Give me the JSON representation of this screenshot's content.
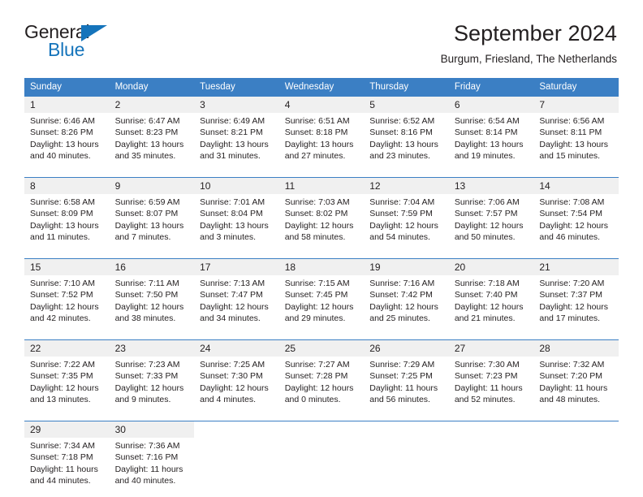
{
  "logo": {
    "word_one": "General",
    "word_two": "Blue",
    "triangle": "triangle-shape",
    "brand_color": "#1574bb"
  },
  "header": {
    "title": "September 2024",
    "location": "Burgum, Friesland, The Netherlands"
  },
  "theme": {
    "header_bg": "#3b7fc4",
    "daynum_bg": "#f0f0f0",
    "cell_bg": "#ffffff",
    "text": "#231f20"
  },
  "weekday_headers": [
    "Sunday",
    "Monday",
    "Tuesday",
    "Wednesday",
    "Thursday",
    "Friday",
    "Saturday"
  ],
  "weeks": [
    {
      "days": [
        {
          "num": "1",
          "sunrise": "Sunrise: 6:46 AM",
          "sunset": "Sunset: 8:26 PM",
          "daylight1": "Daylight: 13 hours",
          "daylight2": "and 40 minutes."
        },
        {
          "num": "2",
          "sunrise": "Sunrise: 6:47 AM",
          "sunset": "Sunset: 8:23 PM",
          "daylight1": "Daylight: 13 hours",
          "daylight2": "and 35 minutes."
        },
        {
          "num": "3",
          "sunrise": "Sunrise: 6:49 AM",
          "sunset": "Sunset: 8:21 PM",
          "daylight1": "Daylight: 13 hours",
          "daylight2": "and 31 minutes."
        },
        {
          "num": "4",
          "sunrise": "Sunrise: 6:51 AM",
          "sunset": "Sunset: 8:18 PM",
          "daylight1": "Daylight: 13 hours",
          "daylight2": "and 27 minutes."
        },
        {
          "num": "5",
          "sunrise": "Sunrise: 6:52 AM",
          "sunset": "Sunset: 8:16 PM",
          "daylight1": "Daylight: 13 hours",
          "daylight2": "and 23 minutes."
        },
        {
          "num": "6",
          "sunrise": "Sunrise: 6:54 AM",
          "sunset": "Sunset: 8:14 PM",
          "daylight1": "Daylight: 13 hours",
          "daylight2": "and 19 minutes."
        },
        {
          "num": "7",
          "sunrise": "Sunrise: 6:56 AM",
          "sunset": "Sunset: 8:11 PM",
          "daylight1": "Daylight: 13 hours",
          "daylight2": "and 15 minutes."
        }
      ]
    },
    {
      "days": [
        {
          "num": "8",
          "sunrise": "Sunrise: 6:58 AM",
          "sunset": "Sunset: 8:09 PM",
          "daylight1": "Daylight: 13 hours",
          "daylight2": "and 11 minutes."
        },
        {
          "num": "9",
          "sunrise": "Sunrise: 6:59 AM",
          "sunset": "Sunset: 8:07 PM",
          "daylight1": "Daylight: 13 hours",
          "daylight2": "and 7 minutes."
        },
        {
          "num": "10",
          "sunrise": "Sunrise: 7:01 AM",
          "sunset": "Sunset: 8:04 PM",
          "daylight1": "Daylight: 13 hours",
          "daylight2": "and 3 minutes."
        },
        {
          "num": "11",
          "sunrise": "Sunrise: 7:03 AM",
          "sunset": "Sunset: 8:02 PM",
          "daylight1": "Daylight: 12 hours",
          "daylight2": "and 58 minutes."
        },
        {
          "num": "12",
          "sunrise": "Sunrise: 7:04 AM",
          "sunset": "Sunset: 7:59 PM",
          "daylight1": "Daylight: 12 hours",
          "daylight2": "and 54 minutes."
        },
        {
          "num": "13",
          "sunrise": "Sunrise: 7:06 AM",
          "sunset": "Sunset: 7:57 PM",
          "daylight1": "Daylight: 12 hours",
          "daylight2": "and 50 minutes."
        },
        {
          "num": "14",
          "sunrise": "Sunrise: 7:08 AM",
          "sunset": "Sunset: 7:54 PM",
          "daylight1": "Daylight: 12 hours",
          "daylight2": "and 46 minutes."
        }
      ]
    },
    {
      "days": [
        {
          "num": "15",
          "sunrise": "Sunrise: 7:10 AM",
          "sunset": "Sunset: 7:52 PM",
          "daylight1": "Daylight: 12 hours",
          "daylight2": "and 42 minutes."
        },
        {
          "num": "16",
          "sunrise": "Sunrise: 7:11 AM",
          "sunset": "Sunset: 7:50 PM",
          "daylight1": "Daylight: 12 hours",
          "daylight2": "and 38 minutes."
        },
        {
          "num": "17",
          "sunrise": "Sunrise: 7:13 AM",
          "sunset": "Sunset: 7:47 PM",
          "daylight1": "Daylight: 12 hours",
          "daylight2": "and 34 minutes."
        },
        {
          "num": "18",
          "sunrise": "Sunrise: 7:15 AM",
          "sunset": "Sunset: 7:45 PM",
          "daylight1": "Daylight: 12 hours",
          "daylight2": "and 29 minutes."
        },
        {
          "num": "19",
          "sunrise": "Sunrise: 7:16 AM",
          "sunset": "Sunset: 7:42 PM",
          "daylight1": "Daylight: 12 hours",
          "daylight2": "and 25 minutes."
        },
        {
          "num": "20",
          "sunrise": "Sunrise: 7:18 AM",
          "sunset": "Sunset: 7:40 PM",
          "daylight1": "Daylight: 12 hours",
          "daylight2": "and 21 minutes."
        },
        {
          "num": "21",
          "sunrise": "Sunrise: 7:20 AM",
          "sunset": "Sunset: 7:37 PM",
          "daylight1": "Daylight: 12 hours",
          "daylight2": "and 17 minutes."
        }
      ]
    },
    {
      "days": [
        {
          "num": "22",
          "sunrise": "Sunrise: 7:22 AM",
          "sunset": "Sunset: 7:35 PM",
          "daylight1": "Daylight: 12 hours",
          "daylight2": "and 13 minutes."
        },
        {
          "num": "23",
          "sunrise": "Sunrise: 7:23 AM",
          "sunset": "Sunset: 7:33 PM",
          "daylight1": "Daylight: 12 hours",
          "daylight2": "and 9 minutes."
        },
        {
          "num": "24",
          "sunrise": "Sunrise: 7:25 AM",
          "sunset": "Sunset: 7:30 PM",
          "daylight1": "Daylight: 12 hours",
          "daylight2": "and 4 minutes."
        },
        {
          "num": "25",
          "sunrise": "Sunrise: 7:27 AM",
          "sunset": "Sunset: 7:28 PM",
          "daylight1": "Daylight: 12 hours",
          "daylight2": "and 0 minutes."
        },
        {
          "num": "26",
          "sunrise": "Sunrise: 7:29 AM",
          "sunset": "Sunset: 7:25 PM",
          "daylight1": "Daylight: 11 hours",
          "daylight2": "and 56 minutes."
        },
        {
          "num": "27",
          "sunrise": "Sunrise: 7:30 AM",
          "sunset": "Sunset: 7:23 PM",
          "daylight1": "Daylight: 11 hours",
          "daylight2": "and 52 minutes."
        },
        {
          "num": "28",
          "sunrise": "Sunrise: 7:32 AM",
          "sunset": "Sunset: 7:20 PM",
          "daylight1": "Daylight: 11 hours",
          "daylight2": "and 48 minutes."
        }
      ]
    },
    {
      "days": [
        {
          "num": "29",
          "sunrise": "Sunrise: 7:34 AM",
          "sunset": "Sunset: 7:18 PM",
          "daylight1": "Daylight: 11 hours",
          "daylight2": "and 44 minutes."
        },
        {
          "num": "30",
          "sunrise": "Sunrise: 7:36 AM",
          "sunset": "Sunset: 7:16 PM",
          "daylight1": "Daylight: 11 hours",
          "daylight2": "and 40 minutes."
        },
        {
          "num": "",
          "sunrise": "",
          "sunset": "",
          "daylight1": "",
          "daylight2": ""
        },
        {
          "num": "",
          "sunrise": "",
          "sunset": "",
          "daylight1": "",
          "daylight2": ""
        },
        {
          "num": "",
          "sunrise": "",
          "sunset": "",
          "daylight1": "",
          "daylight2": ""
        },
        {
          "num": "",
          "sunrise": "",
          "sunset": "",
          "daylight1": "",
          "daylight2": ""
        },
        {
          "num": "",
          "sunrise": "",
          "sunset": "",
          "daylight1": "",
          "daylight2": ""
        }
      ]
    }
  ]
}
